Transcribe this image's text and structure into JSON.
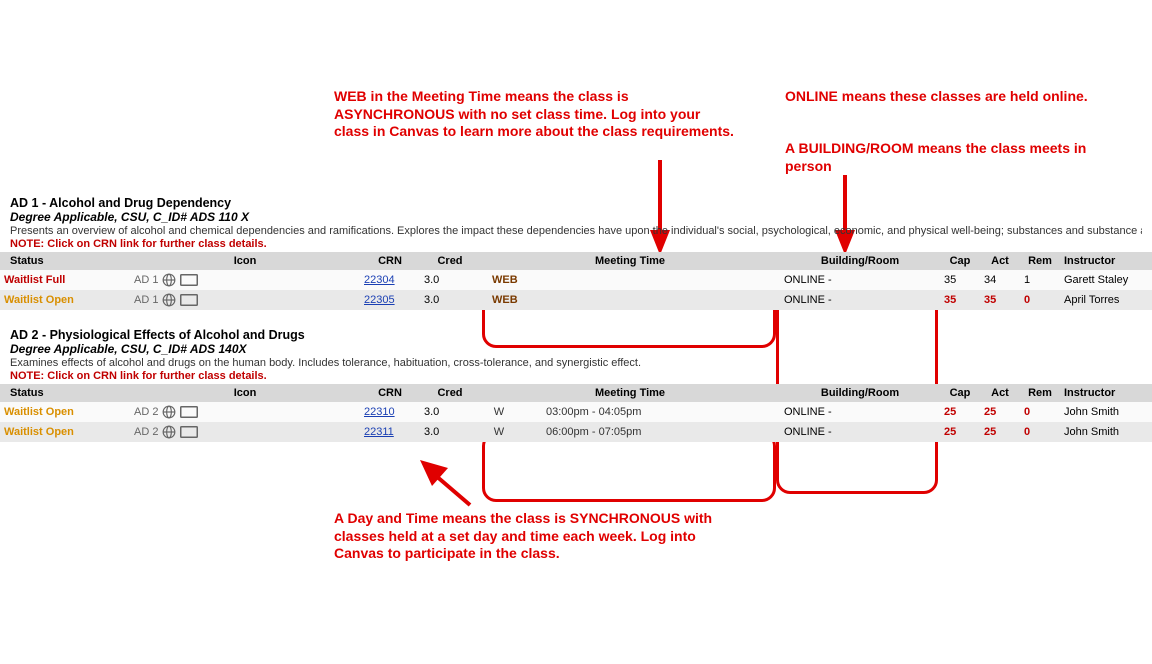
{
  "annotations": {
    "web_note": "WEB in the Meeting Time means the class is ASYNCHRONOUS with no set class time. Log into your class in Canvas to learn more about the class requirements.",
    "online_note": "ONLINE means these classes are held online.",
    "building_note": "A BUILDING/ROOM means the class meets in person",
    "sync_note": "A Day and Time means the class is SYNCHRONOUS with classes held at a set day and time each week. Log into Canvas to participate in the class."
  },
  "headers": {
    "status": "Status",
    "icon": "Icon",
    "crn": "CRN",
    "cred": "Cred",
    "meeting": "Meeting Time",
    "building": "Building/Room",
    "cap": "Cap",
    "act": "Act",
    "rem": "Rem",
    "instructor": "Instructor"
  },
  "note": "NOTE: Click on CRN link for further class details.",
  "courses": [
    {
      "title": "AD 1 - Alcohol and Drug Dependency",
      "subtitle": "Degree Applicable, CSU, C_ID# ADS 110 X",
      "desc": "Presents an overview of alcohol and chemical dependencies and ramifications. Explores the impact these dependencies have upon the individual's social, psychological, economic, and physical well-being; substances and substance abusers. Explores various approaches to recovery. Includes familiarization with terms.",
      "icon_label": "AD 1",
      "rows": [
        {
          "status": "Waitlist Full",
          "status_cls": "status-full",
          "crn": "22304",
          "cred": "3.0",
          "meeting": "WEB",
          "meeting_cls": "web-brown",
          "building": "ONLINE -",
          "cap": "35",
          "act": "34",
          "rem": "1",
          "cap_cls": "",
          "act_cls": "",
          "rem_cls": "",
          "instructor": "Garett Staley",
          "row_cls": "row-a"
        },
        {
          "status": "Waitlist Open",
          "status_cls": "status-open",
          "crn": "22305",
          "cred": "3.0",
          "meeting": "WEB",
          "meeting_cls": "web-brown",
          "building": "ONLINE -",
          "cap": "35",
          "act": "35",
          "rem": "0",
          "cap_cls": "red-num",
          "act_cls": "red-num",
          "rem_cls": "red-num",
          "instructor": "April Torres",
          "row_cls": "row-b"
        }
      ]
    },
    {
      "title": "AD 2 - Physiological Effects of Alcohol and Drugs",
      "subtitle": "Degree Applicable, CSU, C_ID# ADS 140X",
      "desc": "Examines effects of alcohol and drugs on the human body. Includes tolerance, habituation, cross-tolerance, and synergistic effect.",
      "icon_label": "AD 2",
      "rows": [
        {
          "status": "Waitlist Open",
          "status_cls": "status-open",
          "crn": "22310",
          "cred": "3.0",
          "day": "W",
          "time": "03:00pm - 04:05pm",
          "building": "ONLINE -",
          "cap": "25",
          "act": "25",
          "rem": "0",
          "cap_cls": "red-num",
          "act_cls": "red-num",
          "rem_cls": "red-num",
          "instructor": "John Smith",
          "row_cls": "row-a"
        },
        {
          "status": "Waitlist Open",
          "status_cls": "status-open",
          "crn": "22311",
          "cred": "3.0",
          "day": "W",
          "time": "06:00pm - 07:05pm",
          "building": "ONLINE -",
          "cap": "25",
          "act": "25",
          "rem": "0",
          "cap_cls": "red-num",
          "act_cls": "red-num",
          "rem_cls": "red-num",
          "instructor": "John Smith",
          "row_cls": "row-b"
        }
      ]
    }
  ]
}
